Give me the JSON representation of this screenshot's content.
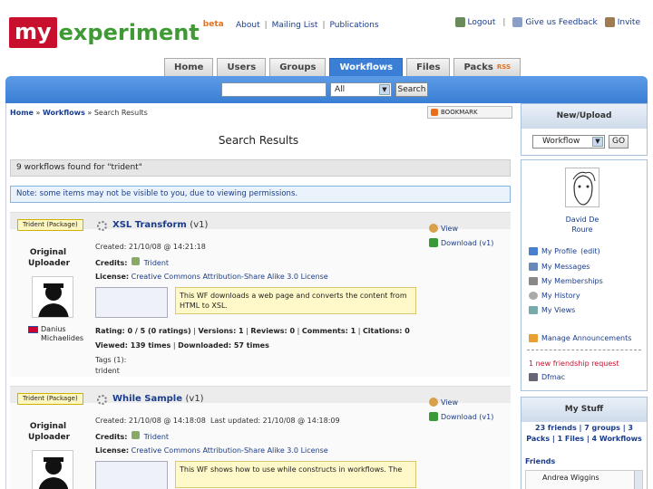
{
  "header": {
    "logo_my": "my",
    "logo_experiment": "experiment",
    "logo_beta": "beta",
    "nav": [
      "About",
      "Mailing List",
      "Publications"
    ],
    "links": {
      "logout": "Logout",
      "feedback": "Give us Feedback",
      "invite": "Invite"
    }
  },
  "tabs": [
    {
      "label": "Home"
    },
    {
      "label": "Users"
    },
    {
      "label": "Groups"
    },
    {
      "label": "Workflows",
      "active": true
    },
    {
      "label": "Files"
    },
    {
      "label": "Packs"
    }
  ],
  "tabs_rss": "RSS",
  "search": {
    "value": "",
    "select": "All",
    "button": "Search"
  },
  "breadcrumb": {
    "home": "Home",
    "sep": "»",
    "workflows": "Workflows",
    "current": "Search Results"
  },
  "bookmark_label": "BOOKMARK",
  "page_title": "Search Results",
  "found_text": "9 workflows found for \"trident\"",
  "note_text": "Note: some items may not be visible to you, due to viewing permissions.",
  "workflows": [
    {
      "badge": "Trident (Package)",
      "uploader_label": "Original Uploader",
      "uploader_name": "Danius Michaelides",
      "title": "XSL Transform",
      "version": "(v1)",
      "created": "Created: 21/10/08 @ 14:21:18",
      "credits_label": "Credits:",
      "credits_value": "Trident",
      "license_label": "License:",
      "license_value": "Creative Commons Attribution-Share Alike 3.0 License",
      "description": "This WF downloads a web page and converts the content from HTML to XSL.",
      "rating": "Rating: 0 / 5 (0 ratings)",
      "versions": "Versions: 1",
      "reviews": "Reviews: 0",
      "comments": "Comments: 1",
      "citations": "Citations: 0",
      "viewed": "Viewed: 139 times",
      "downloaded": "Downloaded: 57 times",
      "tags_label": "Tags (1):",
      "tag": "trident",
      "view_label": "View",
      "download_label": "Download (v1)"
    },
    {
      "badge": "Trident (Package)",
      "uploader_label": "Original Uploader",
      "title": "While Sample",
      "version": "(v1)",
      "created": "Created: 21/10/08 @ 14:18:08",
      "updated": "Last updated: 21/10/08 @ 14:18:09",
      "credits_label": "Credits:",
      "credits_value": "Trident",
      "license_label": "License:",
      "license_value": "Creative Commons Attribution-Share Alike 3.0 License",
      "description": "This WF shows how to use while constructs in workflows. The",
      "view_label": "View",
      "download_label": "Download (v1)"
    }
  ],
  "sidebar": {
    "new_upload_title": "New/Upload",
    "new_upload_select": "Workflow",
    "go_label": "GO",
    "user_name": "David De Roure",
    "menu": [
      {
        "label": "My Profile",
        "extra": "(edit)",
        "color": "#4a7fd0"
      },
      {
        "label": "My Messages",
        "color": "#6688bb"
      },
      {
        "label": "My Memberships",
        "color": "#888"
      },
      {
        "label": "My History",
        "color": "#aaa"
      },
      {
        "label": "My Views",
        "color": "#7aa"
      }
    ],
    "announcements": "Manage Announcements",
    "friend_request": "1 new friendship request",
    "friend_name": "Dfmac",
    "my_stuff_title": "My Stuff",
    "stats_line1": "23 friends | 7 groups | 3 Packs | 1 Files | 4 Workflows",
    "friends_label": "Friends",
    "friend_first": "Andrea Wiggins"
  }
}
